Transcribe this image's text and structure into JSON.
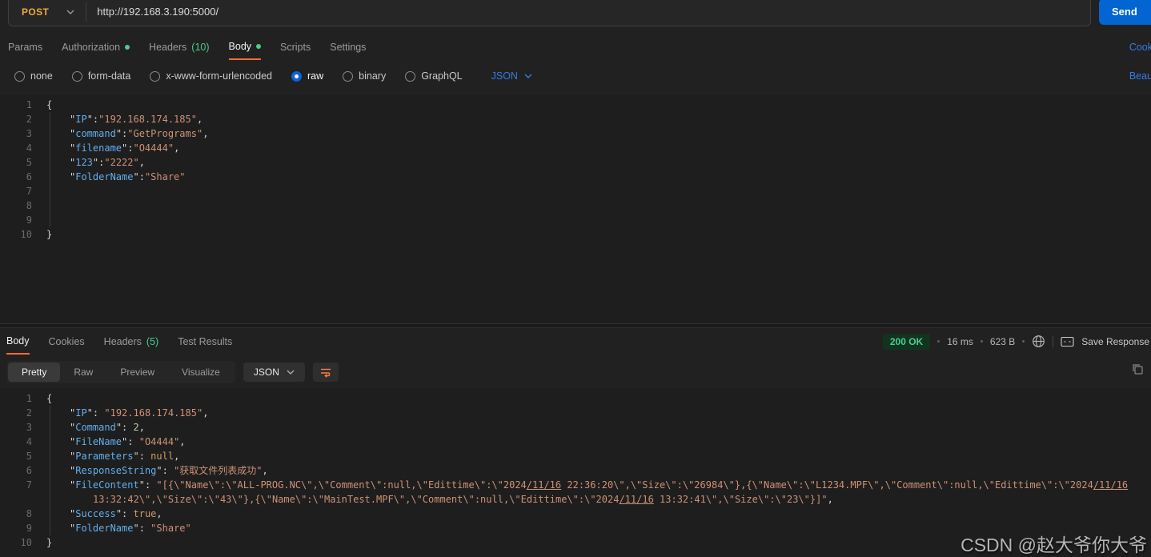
{
  "request_bar": {
    "method": "POST",
    "url": "http://192.168.3.190:5000/",
    "send_label": "Send"
  },
  "request_tabs": {
    "tabs": [
      {
        "label": "Params"
      },
      {
        "label": "Authorization",
        "dot": true
      },
      {
        "label": "Headers",
        "suffix": "(10)"
      },
      {
        "label": "Body",
        "dot": true,
        "active": true
      },
      {
        "label": "Scripts"
      },
      {
        "label": "Settings"
      }
    ],
    "cookies_link": "Cookies"
  },
  "body_type_bar": {
    "options": [
      {
        "label": "none"
      },
      {
        "label": "form-data"
      },
      {
        "label": "x-www-form-urlencoded"
      },
      {
        "label": "raw",
        "selected": true
      },
      {
        "label": "binary"
      },
      {
        "label": "GraphQL"
      }
    ],
    "format_selector": "JSON",
    "beautify_link": "Beautify"
  },
  "request_editor": {
    "rows": [
      {
        "n": "1",
        "i": 0,
        "t": [
          [
            "p",
            "{"
          ]
        ]
      },
      {
        "n": "2",
        "i": 1,
        "t": [
          [
            "p",
            "\""
          ],
          [
            "k",
            "IP"
          ],
          [
            "p",
            "\":"
          ],
          [
            "s",
            "\"192.168.174.185\""
          ],
          [
            "p",
            ","
          ]
        ]
      },
      {
        "n": "3",
        "i": 1,
        "t": [
          [
            "p",
            "\""
          ],
          [
            "k",
            "command"
          ],
          [
            "p",
            "\":"
          ],
          [
            "s",
            "\"GetPrograms\""
          ],
          [
            "p",
            ","
          ]
        ]
      },
      {
        "n": "4",
        "i": 1,
        "t": [
          [
            "p",
            "\""
          ],
          [
            "k",
            "filename"
          ],
          [
            "p",
            "\":"
          ],
          [
            "s",
            "\"O4444\""
          ],
          [
            "p",
            ","
          ]
        ]
      },
      {
        "n": "5",
        "i": 1,
        "t": [
          [
            "p",
            "\""
          ],
          [
            "k",
            "123"
          ],
          [
            "p",
            "\":"
          ],
          [
            "s",
            "\"2222\""
          ],
          [
            "p",
            ","
          ]
        ]
      },
      {
        "n": "6",
        "i": 1,
        "t": [
          [
            "p",
            "\""
          ],
          [
            "k",
            "FolderName"
          ],
          [
            "p",
            "\":"
          ],
          [
            "s",
            "\"Share\""
          ]
        ]
      },
      {
        "n": "7",
        "i": 1,
        "t": []
      },
      {
        "n": "8",
        "i": 1,
        "t": []
      },
      {
        "n": "9",
        "i": 1,
        "t": []
      },
      {
        "n": "10",
        "i": 0,
        "t": [
          [
            "p",
            "}"
          ]
        ]
      }
    ]
  },
  "response_section": {
    "tabs": [
      {
        "label": "Body",
        "active": true
      },
      {
        "label": "Cookies"
      },
      {
        "label": "Headers",
        "suffix": "(5)"
      },
      {
        "label": "Test Results"
      }
    ],
    "status": "200 OK",
    "time": "16 ms",
    "size": "623 B",
    "save_label": "Save Response",
    "view_tabs": [
      {
        "label": "Pretty",
        "active": true
      },
      {
        "label": "Raw"
      },
      {
        "label": "Preview"
      },
      {
        "label": "Visualize"
      }
    ],
    "format_selector": "JSON"
  },
  "response_editor": {
    "rows": [
      {
        "n": "1",
        "i": 0,
        "t": [
          [
            "p",
            "{"
          ]
        ]
      },
      {
        "n": "2",
        "i": 1,
        "t": [
          [
            "p",
            "\""
          ],
          [
            "k",
            "IP"
          ],
          [
            "p",
            "\": "
          ],
          [
            "s",
            "\"192.168.174.185\""
          ],
          [
            "p",
            ","
          ]
        ]
      },
      {
        "n": "3",
        "i": 1,
        "t": [
          [
            "p",
            "\""
          ],
          [
            "k",
            "Command"
          ],
          [
            "p",
            "\": "
          ],
          [
            "d",
            "2"
          ],
          [
            "p",
            ","
          ]
        ]
      },
      {
        "n": "4",
        "i": 1,
        "t": [
          [
            "p",
            "\""
          ],
          [
            "k",
            "FileName"
          ],
          [
            "p",
            "\": "
          ],
          [
            "s",
            "\"O4444\""
          ],
          [
            "p",
            ","
          ]
        ]
      },
      {
        "n": "5",
        "i": 1,
        "t": [
          [
            "p",
            "\""
          ],
          [
            "k",
            "Parameters"
          ],
          [
            "p",
            "\": "
          ],
          [
            "l",
            "null"
          ],
          [
            "p",
            ","
          ]
        ]
      },
      {
        "n": "6",
        "i": 1,
        "t": [
          [
            "p",
            "\""
          ],
          [
            "k",
            "ResponseString"
          ],
          [
            "p",
            "\": "
          ],
          [
            "s",
            "\"获取文件列表成功\""
          ],
          [
            "p",
            ","
          ]
        ]
      },
      {
        "n": "7",
        "i": 1,
        "t": [
          [
            "p",
            "\""
          ],
          [
            "k",
            "FileContent"
          ],
          [
            "p",
            "\": "
          ],
          [
            "s",
            "\"[{\\\"Name\\\":\\\"ALL-PROG.NC\\\",\\\"Comment\\\":null,\\\"Edittime\\\":\\\"2024"
          ],
          [
            "u",
            "/11/16"
          ],
          [
            "s",
            " 22:36:20\\\",\\\"Size\\\":\\\"26984\\\"},{\\\"Name\\\":\\\"L1234.MPF\\\",\\\"Comment\\\":null,\\\"Edittime\\\":\\\"2024"
          ],
          [
            "u",
            "/11/16"
          ]
        ]
      },
      {
        "n": "",
        "i": 2,
        "t": [
          [
            "s",
            "13:32:42\\\",\\\"Size\\\":\\\"43\\\"},{\\\"Name\\\":\\\"MainTest.MPF\\\",\\\"Comment\\\":null,\\\"Edittime\\\":\\\"2024"
          ],
          [
            "u",
            "/11/16"
          ],
          [
            "s",
            " 13:32:41\\\",\\\"Size\\\":\\\"23\\\"}]\""
          ],
          [
            "p",
            ","
          ]
        ]
      },
      {
        "n": "8",
        "i": 1,
        "t": [
          [
            "p",
            "\""
          ],
          [
            "k",
            "Success"
          ],
          [
            "p",
            "\": "
          ],
          [
            "l",
            "true"
          ],
          [
            "p",
            ","
          ]
        ]
      },
      {
        "n": "9",
        "i": 1,
        "t": [
          [
            "p",
            "\""
          ],
          [
            "k",
            "FolderName"
          ],
          [
            "p",
            "\": "
          ],
          [
            "s",
            "\"Share\""
          ]
        ]
      },
      {
        "n": "10",
        "i": 0,
        "t": [
          [
            "p",
            "}"
          ]
        ]
      }
    ]
  },
  "watermark": "CSDN @赵大爷你大爷"
}
